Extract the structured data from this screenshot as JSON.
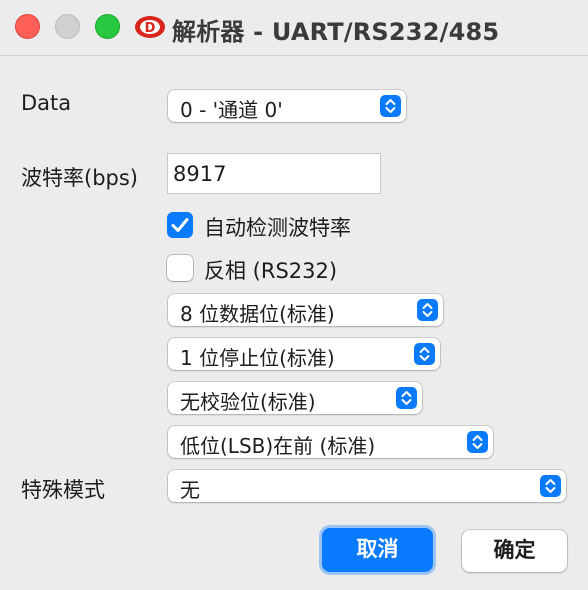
{
  "window": {
    "title": "解析器 - UART/RS232/485",
    "app_icon": "logic-analyzer-logo-icon",
    "traffic_lights": [
      "close",
      "minimize",
      "zoom"
    ]
  },
  "form": {
    "data": {
      "label": "Data",
      "selected": "0 - '通道 0'"
    },
    "baud": {
      "label": "波特率(bps)",
      "value": "8917"
    },
    "auto_baud": {
      "label": "自动检测波特率",
      "checked": true
    },
    "invert": {
      "label": "反相 (RS232)",
      "checked": false
    },
    "data_bits": {
      "selected": "8 位数据位(标准)"
    },
    "stop_bits": {
      "selected": "1 位停止位(标准)"
    },
    "parity": {
      "selected": "无校验位(标准)"
    },
    "bit_order": {
      "selected": "低位(LSB)在前 (标准)"
    },
    "special_mode": {
      "label": "特殊模式",
      "selected": "无"
    }
  },
  "buttons": {
    "cancel_label": "取消",
    "ok_label": "确定"
  },
  "colors": {
    "accent": "#0a7aff",
    "close": "#fe5f57",
    "zoom": "#28c840",
    "background": "#ececec"
  }
}
